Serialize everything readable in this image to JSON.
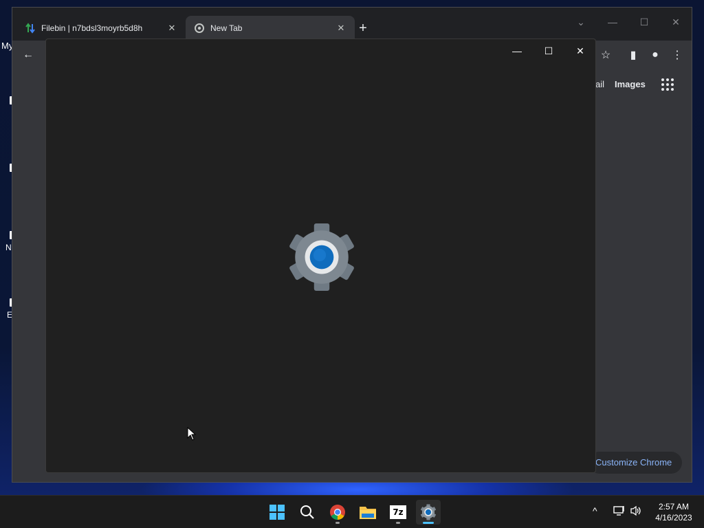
{
  "desktop": {
    "labels": [
      "My",
      "N",
      "E"
    ]
  },
  "chrome": {
    "tabs": [
      {
        "title": "Filebin | n7bdsl3moyrb5d8h",
        "close": "✕"
      },
      {
        "title": "New Tab",
        "close": "✕"
      }
    ],
    "new_tab": "+",
    "window_controls": {
      "search_tabs": "⌄",
      "minimize": "—",
      "maximize": "☐",
      "close": "✕"
    },
    "toolbar": {
      "back": "←",
      "bookmark": "☆",
      "side_panel": "▮",
      "profile": "●",
      "menu": "⋮"
    },
    "ntp": {
      "gmail_partial": "ail",
      "images": "Images",
      "customize": "Customize Chrome"
    }
  },
  "settings_window": {
    "controls": {
      "minimize": "—",
      "maximize": "☐",
      "close": "✕"
    },
    "icon": "settings-gear-icon"
  },
  "taskbar": {
    "apps": [
      "start-icon",
      "search-icon",
      "chrome-icon",
      "file-explorer-icon",
      "7zip-icon",
      "settings-icon"
    ],
    "sevenzip_label": "7z",
    "tray": {
      "chevron": "^",
      "network": "⧉",
      "volume": "🔈"
    },
    "clock": {
      "time": "2:57 AM",
      "date": "4/16/2023"
    }
  }
}
